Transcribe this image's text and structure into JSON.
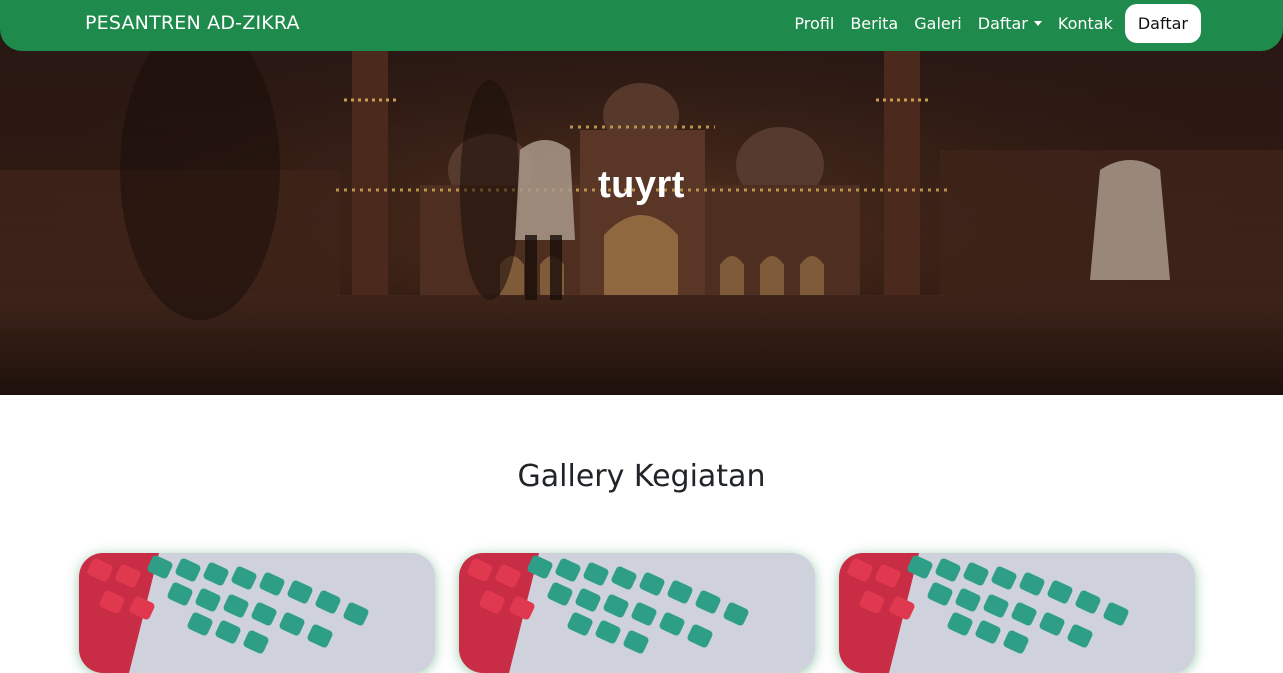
{
  "navbar": {
    "brand": "PESANTREN AD-ZIKRA",
    "links": [
      {
        "label": "Profil"
      },
      {
        "label": "Berita"
      },
      {
        "label": "Galeri"
      },
      {
        "label": "Daftar",
        "dropdown": true
      },
      {
        "label": "Kontak"
      }
    ],
    "cta_label": "Daftar"
  },
  "hero": {
    "title": "tuyrt"
  },
  "gallery": {
    "title": "Gallery Kegiatan",
    "cards": [
      {
        "icon": "keyboard-photo"
      },
      {
        "icon": "keyboard-photo"
      },
      {
        "icon": "keyboard-photo"
      }
    ]
  },
  "colors": {
    "navbar_bg": "#1e8a4c",
    "cta_bg": "#ffffff",
    "hero_overlay": "#2a1b18"
  }
}
